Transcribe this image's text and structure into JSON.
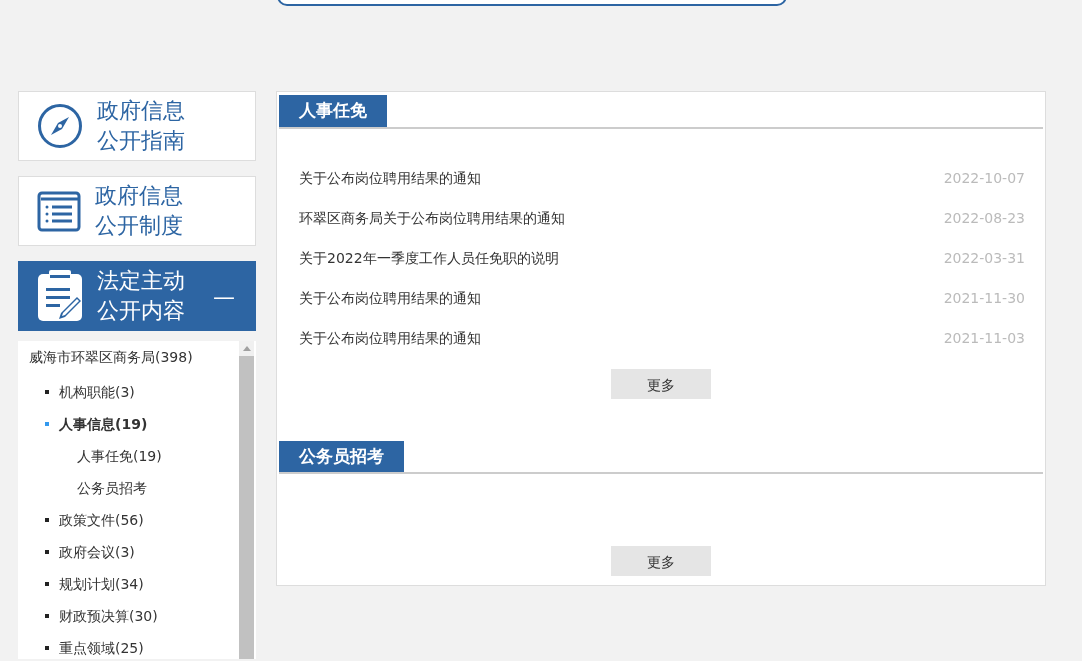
{
  "search": {
    "kind": "field"
  },
  "side_cards": [
    {
      "kind": "compass",
      "line1": "政府信息",
      "line2": "公开指南",
      "selected": false
    },
    {
      "kind": "list",
      "line1": "政府信息",
      "line2": "公开制度",
      "selected": false
    },
    {
      "kind": "clipboard",
      "line1": "法定主动",
      "line2": "公开内容",
      "selected": true,
      "toggle": "—"
    }
  ],
  "tree": {
    "label": "威海市环翠区商务局(398)",
    "children": [
      {
        "label": "机构职能(3)",
        "selected": false
      },
      {
        "label": "人事信息(19)",
        "selected": true,
        "expanded": true,
        "children": [
          {
            "label": "人事任免(19)"
          },
          {
            "label": "公务员招考"
          }
        ]
      },
      {
        "label": "政策文件(56)",
        "selected": false
      },
      {
        "label": "政府会议(3)",
        "selected": false
      },
      {
        "label": "规划计划(34)",
        "selected": false
      },
      {
        "label": "财政预决算(30)",
        "selected": false
      },
      {
        "label": "重点领域(25)",
        "selected": false
      }
    ]
  },
  "sections": [
    {
      "title": "人事任免",
      "items": [
        {
          "title": "关于公布岗位聘用结果的通知",
          "date": "2022-10-07"
        },
        {
          "title": "环翠区商务局关于公布岗位聘用结果的通知",
          "date": "2022-08-23"
        },
        {
          "title": "关于2022年一季度工作人员任免职的说明",
          "date": "2022-03-31"
        },
        {
          "title": "关于公布岗位聘用结果的通知",
          "date": "2021-11-30"
        },
        {
          "title": "关于公布岗位聘用结果的通知",
          "date": "2021-11-03"
        }
      ],
      "more": "更多"
    },
    {
      "title": "公务员招考",
      "more": "更多"
    }
  ]
}
